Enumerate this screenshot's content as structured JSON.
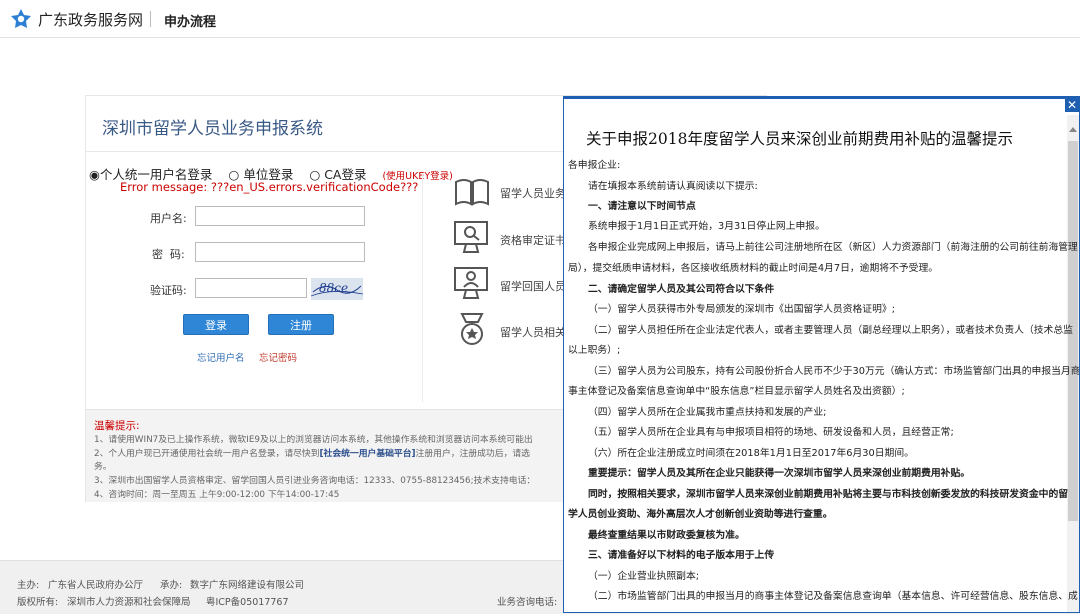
{
  "header": {
    "site_name": "广东政务服务网",
    "section": "申办流程"
  },
  "system_title": "深圳市留学人员业务申报系统",
  "login": {
    "types": [
      "个人统一用户名登录",
      "单位登录",
      "CA登录"
    ],
    "ukey_note": "(使用UKEY登录)",
    "error": "Error message: ???en_US.errors.verificationCode???",
    "username_label": "用户名:",
    "password_label": "密  码:",
    "captcha_label": "验证码:",
    "captcha_text": "88ce",
    "login_button": "登录",
    "register_button": "注册",
    "forgot_username": "忘记用户名",
    "forgot_password": "忘记密码"
  },
  "side_menu": [
    {
      "label": "留学人员业务",
      "icon": "book-icon"
    },
    {
      "label": "资格审定证书",
      "icon": "monitor-search-icon"
    },
    {
      "label": "留学回国人员",
      "icon": "monitor-user-icon"
    },
    {
      "label": "留学人员相关",
      "icon": "medal-icon"
    }
  ],
  "tips": {
    "title": "温馨提示:",
    "line1": "1、请使用WIN7及已上操作系统，微软IE9及以上的浏览器访问本系统，其他操作系统和浏览器访问本系统可能出",
    "line2_pre": "2、个人用户现已开通使用社会统一用户名登录，请尽快到",
    "line2_link": "[社会统一用户基础平台]",
    "line2_post": "注册用户，注册成功后，请选",
    "line2b": "务。",
    "line3": "3、深圳市出国留学人员资格审定、留学回国人员引进业务咨询电话：12333、0755-88123456;技术支持电话：",
    "line4": "4、咨询时间：周一至周五 上午9:00-12:00 下午14:00-17:45"
  },
  "footer": {
    "host_label": "主办:",
    "host": "广东省人民政府办公厅",
    "undertake_label": "承办:",
    "undertake": "数字广东网络建设有限公司",
    "copyright_label": "版权所有:",
    "copyright": "深圳市人力资源和社会保障局",
    "icp": "粤ICP备05017767",
    "hotline": "业务咨询电话:"
  },
  "modal": {
    "title": "关于申报2018年度留学人员来深创业前期费用补贴的温馨提示",
    "paragraphs": [
      "各申报企业:",
      "请在填报本系统前请认真阅读以下提示:",
      "一、请注意以下时间节点",
      "系统申报于1月1日正式开始，3月31日停止网上申报。",
      "各申报企业完成网上申报后，请马上前往公司注册地所在区（新区）人力资源部门（前海注册的公司前往前海管理",
      "局），提交纸质申请材料，各区接收纸质材料的截止时间是4月7日，逾期将不予受理。",
      "二、请确定留学人员及其公司符合以下条件",
      "（一）留学人员获得市外专局颁发的深圳市《出国留学人员资格证明》;",
      "（二）留学人员担任所在企业法定代表人，或者主要管理人员（副总经理以上职务），或者技术负责人（技术总监",
      "以上职务）;",
      "（三）留学人员为公司股东，持有公司股份折合人民币不少于30万元（确认方式：市场监管部门出具的申报当月商",
      "事主体登记及备案信息查询单中“股东信息”栏目显示留学人员姓名及出资额）;",
      "（四）留学人员所在企业属我市重点扶持和发展的产业;",
      "（五）留学人员所在企业具有与申报项目相符的场地、研发设备和人员，且经营正常;",
      "（六）所在企业注册成立时间须在2018年1月1日至2017年6月30日期间。",
      "重要提示：留学人员及其所在企业只能获得一次深圳市留学人员来深创业前期费用补贴。",
      "同时，按照相关要求，深圳市留学人员来深创业前期费用补贴将主要与市科技创新委发放的科技研发资金中的留",
      "学人员创业资助、海外高层次人才创新创业资助等进行查重。",
      "最终查重结果以市财政委复核为准。",
      "三、请准备好以下材料的电子版本用于上传",
      "（一）企业营业执照副本;",
      "（二）市场监管部门出具的申报当月的商事主体登记及备案信息查询单（基本信息、许可经营信息、股东信息、成"
    ]
  }
}
